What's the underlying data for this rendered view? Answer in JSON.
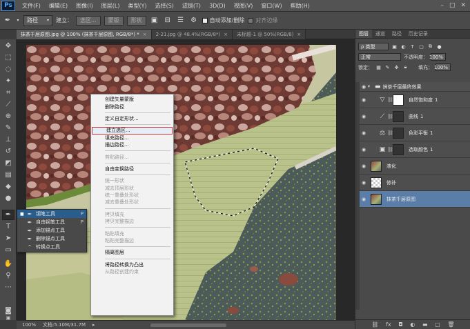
{
  "app": {
    "logo": "Ps"
  },
  "menubar": {
    "items": [
      "文件(F)",
      "编辑(E)",
      "图像(I)",
      "图层(L)",
      "类型(Y)",
      "选择(S)",
      "滤镜(T)",
      "3D(D)",
      "视图(V)",
      "窗口(W)",
      "帮助(H)"
    ],
    "window_controls": [
      "–",
      "□",
      "✕"
    ]
  },
  "options": {
    "mode_select": "路径",
    "make_label": "建立：",
    "selection_btn": "选区...",
    "mask_btn": "蒙版",
    "shape_btn": "形状",
    "auto_add_delete": "自动添加/删除",
    "align_edges": "对齐边缘"
  },
  "tabs": [
    {
      "label": "抹茶千层原图.jpg @ 100% (抹茶千层原图, RGB/8*) *",
      "active": true
    },
    {
      "label": "2-21.jpg @ 48.4%(RGB/8*)",
      "active": false
    },
    {
      "label": "未标题-1 @ 50%(RGB/8)",
      "active": false
    }
  ],
  "pen_flyout": [
    {
      "label": "钢笔工具",
      "key": "P",
      "selected": true,
      "icon": "pen-icon"
    },
    {
      "label": "自由钢笔工具",
      "key": "P",
      "selected": false,
      "icon": "freeform-pen-icon"
    },
    {
      "label": "添加锚点工具",
      "key": "",
      "selected": false,
      "icon": "add-anchor-icon"
    },
    {
      "label": "删除锚点工具",
      "key": "",
      "selected": false,
      "icon": "delete-anchor-icon"
    },
    {
      "label": "转换点工具",
      "key": "",
      "selected": false,
      "icon": "convert-point-icon"
    }
  ],
  "context_menu": [
    {
      "label": "创建矢量蒙版",
      "enabled": true
    },
    {
      "label": "删除路径",
      "enabled": true
    },
    {
      "sep": true
    },
    {
      "label": "定义自定形状...",
      "enabled": true
    },
    {
      "sep": true
    },
    {
      "label": "建立选区...",
      "enabled": true,
      "highlight": true
    },
    {
      "label": "填充路径...",
      "enabled": true
    },
    {
      "label": "描边路径...",
      "enabled": true
    },
    {
      "sep": true
    },
    {
      "label": "剪贴路径...",
      "enabled": false
    },
    {
      "sep": true
    },
    {
      "label": "自由变换路径",
      "enabled": true
    },
    {
      "sep": true
    },
    {
      "label": "统一形状",
      "enabled": false
    },
    {
      "label": "减去顶层形状",
      "enabled": false
    },
    {
      "label": "统一重叠处形状",
      "enabled": false
    },
    {
      "label": "减去重叠处形状",
      "enabled": false
    },
    {
      "sep": true
    },
    {
      "label": "拷贝填充",
      "enabled": false
    },
    {
      "label": "拷贝完整描边",
      "enabled": false
    },
    {
      "sep": true
    },
    {
      "label": "粘贴填充",
      "enabled": false
    },
    {
      "label": "粘贴完整描边",
      "enabled": false
    },
    {
      "sep": true
    },
    {
      "label": "隔离图层",
      "enabled": true
    },
    {
      "sep": true
    },
    {
      "label": "将路径转换为凸出",
      "enabled": true
    },
    {
      "label": "从路径创建约束",
      "enabled": false
    }
  ],
  "status": {
    "zoom": "100%",
    "doc": "文档:5.10M/31.7M"
  },
  "panel": {
    "tabs": [
      "图层",
      "通道",
      "路径",
      "历史记录"
    ],
    "filter_kind": "ρ 类型",
    "blend_mode": "正常",
    "opacity_label": "不透明度：",
    "opacity": "100%",
    "lock_label": "锁定：",
    "fill_label": "填充：",
    "fill": "100%"
  },
  "layers": [
    {
      "name": "抹茶千层最终效果",
      "type": "group"
    },
    {
      "name": "自然饱和度",
      "num": "1",
      "type": "adj",
      "icon": "▽",
      "thumb": "white"
    },
    {
      "name": "曲线",
      "num": "1",
      "type": "adj",
      "icon": "⟋",
      "thumb": "dark"
    },
    {
      "name": "色彩平衡",
      "num": "1",
      "type": "adj",
      "icon": "⚖",
      "thumb": "dark"
    },
    {
      "name": "选取颜色",
      "num": "1",
      "type": "adj",
      "icon": "▣",
      "thumb": "dark"
    },
    {
      "name": "液化",
      "type": "pixel",
      "thumb": "photo"
    },
    {
      "name": "修补",
      "type": "pixel",
      "thumb": "checker"
    },
    {
      "name": "抹茶千层原图",
      "type": "pixel",
      "thumb": "photo",
      "selected": true
    }
  ]
}
